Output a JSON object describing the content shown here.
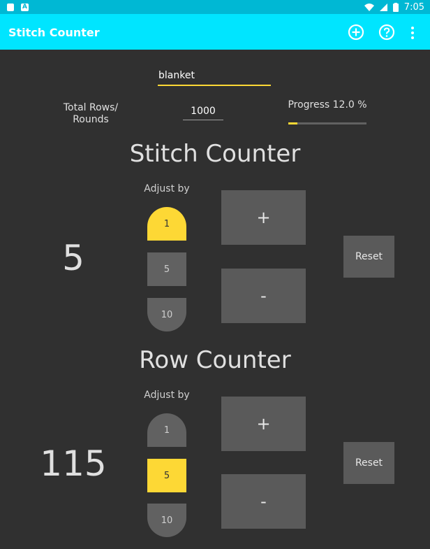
{
  "status_bar": {
    "time": "7:05"
  },
  "app_bar": {
    "title": "Stitch Counter",
    "icons": [
      "add-circle-icon",
      "help-circle-icon",
      "overflow-menu-icon"
    ]
  },
  "project": {
    "name": "blanket",
    "total_rows_label": "Total Rows/\nRounds",
    "total_rows_value": "1000",
    "progress_label": "Progress 12.0 %",
    "progress_fraction": 0.12
  },
  "stitch_counter": {
    "title": "Stitch Counter",
    "adjust_label": "Adjust by",
    "options": [
      "1",
      "5",
      "10"
    ],
    "selected_index": 0,
    "count": "5",
    "plus_label": "+",
    "minus_label": "-",
    "reset_label": "Reset"
  },
  "row_counter": {
    "title": "Row Counter",
    "adjust_label": "Adjust by",
    "options": [
      "1",
      "5",
      "10"
    ],
    "selected_index": 1,
    "count": "115",
    "plus_label": "+",
    "minus_label": "-",
    "reset_label": "Reset"
  },
  "colors": {
    "app_bar": "#00e5ff",
    "status_bar": "#00b8d4",
    "accent": "#fdd835",
    "background": "#303030"
  }
}
